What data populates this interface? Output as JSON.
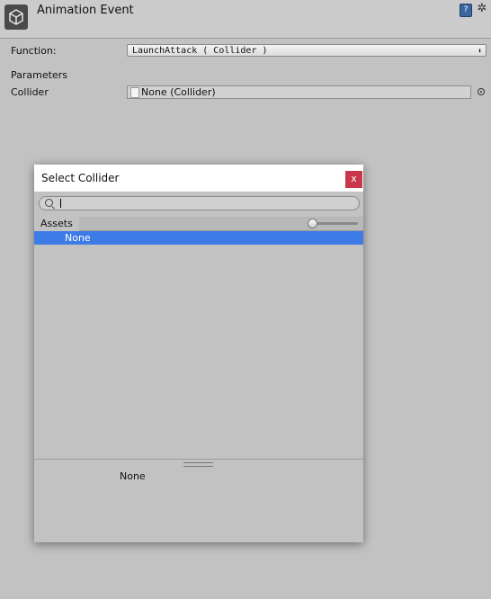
{
  "header": {
    "title": "Animation Event",
    "help_glyph": "?",
    "gear_glyph": "✲"
  },
  "function_row": {
    "label": "Function:",
    "value": "LaunchAttack ( Collider )",
    "arrows": "⬍"
  },
  "parameters": {
    "heading": "Parameters",
    "collider_label": "Collider",
    "collider_value": "None (Collider)"
  },
  "dialog": {
    "title": "Select Collider",
    "close_label": "x",
    "search_value": "",
    "tab_label": "Assets",
    "items": [
      {
        "label": "None",
        "selected": true
      }
    ],
    "preview_label": "None",
    "zoom_slider_value": 0.0
  },
  "colors": {
    "selection": "#3d7be6",
    "close_button": "#c8374a",
    "background": "#c2c2c2"
  }
}
